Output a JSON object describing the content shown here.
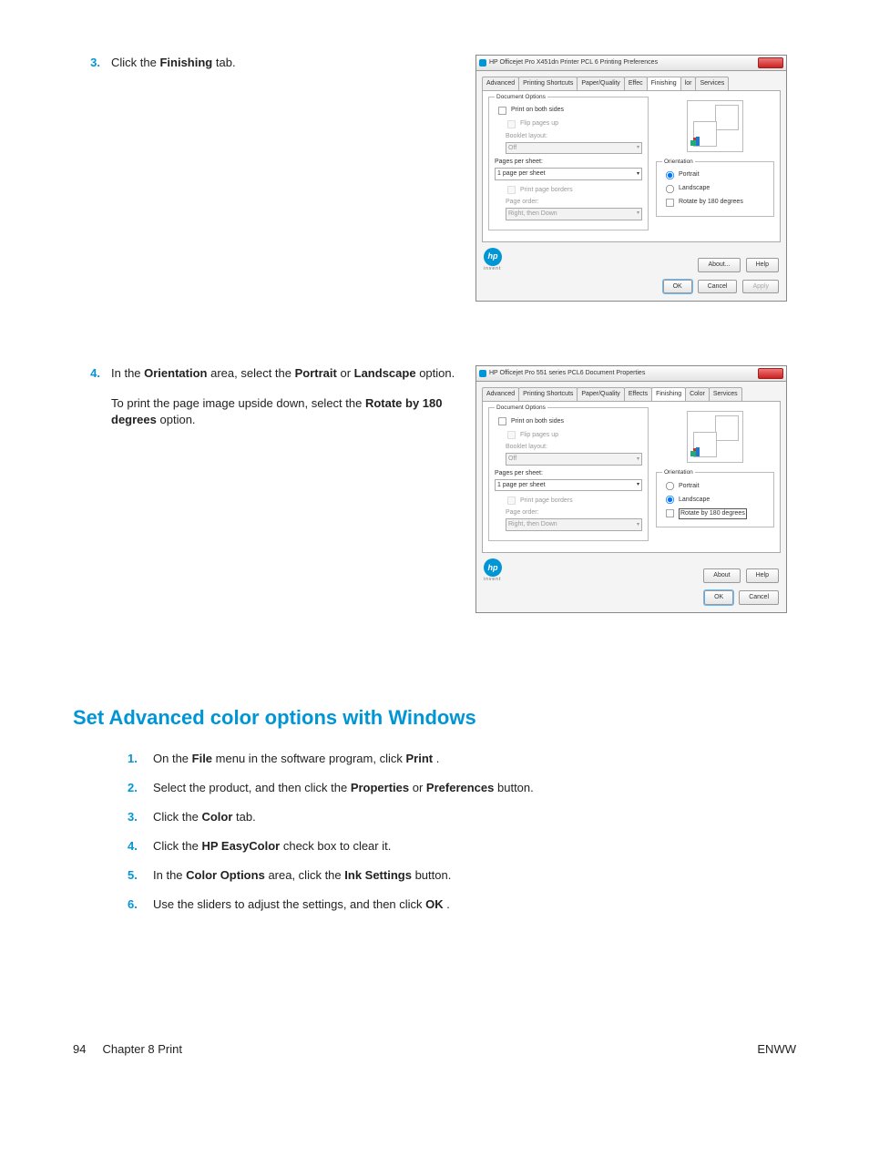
{
  "step3": {
    "num": "3.",
    "text_pre": "Click the ",
    "text_b": "Finishing",
    "text_post": " tab."
  },
  "step4": {
    "num": "4.",
    "p1_pre": "In the ",
    "p1_b1": "Orientation",
    "p1_mid": " area, select the ",
    "p1_b2": "Portrait",
    "p1_mid2": " or ",
    "p1_b3": "Landscape",
    "p1_post": " option.",
    "p2_pre": "To print the page image upside down, select the ",
    "p2_b": "Rotate by 180 degrees",
    "p2_post": " option."
  },
  "dlg1": {
    "title": "HP Officejet Pro X451dn Printer PCL 6 Printing Preferences",
    "tabs": [
      "Advanced",
      "Printing Shortcuts",
      "Paper/Quality",
      "Effec",
      "Finishing",
      "lor",
      "Services"
    ],
    "docopt": "Document Options",
    "pbs": "Print on both sides",
    "flip": "Flip pages up",
    "booklet": "Booklet layout:",
    "off": "Off",
    "pps_lbl": "Pages per sheet:",
    "pps": "1 page per sheet",
    "borders": "Print page borders",
    "pageorder": "Page order:",
    "rtd": "Right, then Down",
    "orient": "Orientation",
    "portrait": "Portrait",
    "landscape": "Landscape",
    "rotate": "Rotate by 180 degrees",
    "about": "About...",
    "help": "Help",
    "ok": "OK",
    "cancel": "Cancel",
    "apply": "Apply"
  },
  "dlg2": {
    "title": "HP Officejet Pro 551 series PCL6 Document Properties",
    "tabs": [
      "Advanced",
      "Printing Shortcuts",
      "Paper/Quality",
      "Effects",
      "Finishing",
      "Color",
      "Services"
    ],
    "docopt": "Document Options",
    "pbs": "Print on both sides",
    "flip": "Flip pages up",
    "booklet": "Booklet layout:",
    "off": "Off",
    "pps_lbl": "Pages per sheet:",
    "pps": "1 page per sheet",
    "borders": "Print page borders",
    "pageorder": "Page order:",
    "rtd": "Right, then Down",
    "orient": "Orientation",
    "portrait": "Portrait",
    "landscape": "Landscape",
    "rotate": "Rotate by 180 degrees",
    "about": "About",
    "help": "Help",
    "ok": "OK",
    "cancel": "Cancel"
  },
  "section": {
    "heading": "Set Advanced color options with Windows",
    "s1": {
      "n": "1.",
      "pre": "On the ",
      "b1": "File",
      "mid": " menu in the software program, click ",
      "b2": "Print",
      "post": "."
    },
    "s2": {
      "n": "2.",
      "pre": "Select the product, and then click the ",
      "b1": "Properties",
      "mid": " or ",
      "b2": "Preferences",
      "post": " button."
    },
    "s3": {
      "n": "3.",
      "pre": "Click the ",
      "b1": "Color",
      "post": " tab."
    },
    "s4": {
      "n": "4.",
      "pre": "Click the ",
      "b1": "HP EasyColor",
      "post": " check box to clear it."
    },
    "s5": {
      "n": "5.",
      "pre": "In the ",
      "b1": "Color Options",
      "mid": " area, click the ",
      "b2": "Ink Settings",
      "post": " button."
    },
    "s6": {
      "n": "6.",
      "pre": "Use the sliders to adjust the settings, and then click ",
      "b1": "OK",
      "post": "."
    }
  },
  "footer": {
    "page": "94",
    "chapter": "Chapter 8   Print",
    "right": "ENWW"
  }
}
